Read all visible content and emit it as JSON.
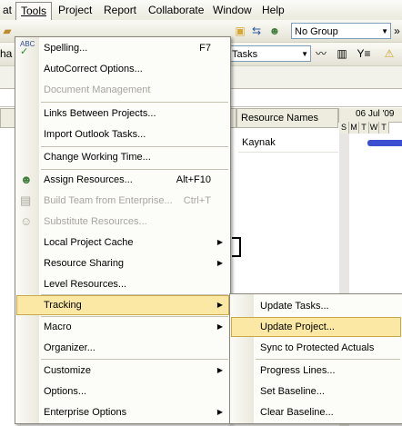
{
  "menubar": {
    "items": [
      "at",
      "Tools",
      "Project",
      "Report",
      "Collaborate",
      "Window",
      "Help"
    ]
  },
  "toolbar": {
    "group_combo": "No Group",
    "filter_combo": "Tasks",
    "left_fragment_row1": "",
    "left_fragment_row2": "ha"
  },
  "grid": {
    "resource_header": "Resource Names",
    "resource_value": "Kaynak",
    "timescale_week": "06 Jul '09",
    "timescale_days": [
      "S",
      "M",
      "T",
      "W",
      "T"
    ]
  },
  "tools_menu": {
    "items": [
      {
        "label": "Spelling...",
        "shortcut": "F7",
        "enabled": true,
        "icon": "spelling-icon"
      },
      {
        "label": "AutoCorrect Options...",
        "enabled": true
      },
      {
        "label": "Document Management",
        "enabled": false
      },
      {
        "label": "Links Between Projects...",
        "enabled": true
      },
      {
        "label": "Import Outlook Tasks...",
        "enabled": true
      },
      {
        "label": "Change Working Time...",
        "enabled": true
      },
      {
        "label": "Assign Resources...",
        "shortcut": "Alt+F10",
        "enabled": true,
        "icon": "assign-resources-icon"
      },
      {
        "label": "Build Team from Enterprise...",
        "shortcut": "Ctrl+T",
        "enabled": false,
        "icon": "build-team-icon"
      },
      {
        "label": "Substitute Resources...",
        "enabled": false,
        "icon": "substitute-resources-icon"
      },
      {
        "label": "Local Project Cache",
        "enabled": true,
        "submenu": true
      },
      {
        "label": "Resource Sharing",
        "enabled": true,
        "submenu": true
      },
      {
        "label": "Level Resources...",
        "enabled": true
      },
      {
        "label": "Tracking",
        "enabled": true,
        "submenu": true,
        "highlighted": true
      },
      {
        "label": "Macro",
        "enabled": true,
        "submenu": true
      },
      {
        "label": "Organizer...",
        "enabled": true
      },
      {
        "label": "Customize",
        "enabled": true,
        "submenu": true
      },
      {
        "label": "Options...",
        "enabled": true
      },
      {
        "label": "Enterprise Options",
        "enabled": true,
        "submenu": true
      }
    ]
  },
  "tracking_menu": {
    "items": [
      {
        "label": "Update Tasks..."
      },
      {
        "label": "Update Project...",
        "highlighted": true
      },
      {
        "label": "Sync to Protected Actuals"
      },
      {
        "label": "Progress Lines..."
      },
      {
        "label": "Set Baseline..."
      },
      {
        "label": "Clear Baseline..."
      }
    ]
  },
  "colors": {
    "highlight": "#fbe8a4",
    "gantt_bar": "#3d4fd1"
  }
}
